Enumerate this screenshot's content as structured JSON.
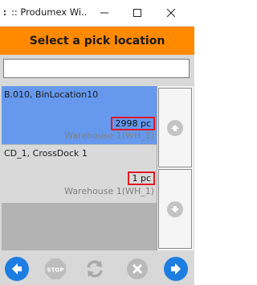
{
  "window": {
    "title": ":: Produmex Wi..."
  },
  "header": {
    "title": "Select a pick location"
  },
  "filter": {
    "value": "",
    "placeholder": ""
  },
  "locations": [
    {
      "name": "B.010, BinLocation10",
      "quantity": "2998 pc",
      "warehouse": "Warehouse 1(WH_1)",
      "selected": true
    },
    {
      "name": "CD_1, CrossDock 1",
      "quantity": "1 pc",
      "warehouse": "Warehouse 1(WH_1)",
      "selected": false
    }
  ],
  "colors": {
    "header": "#ff8a00",
    "selected_row": "#6699ee",
    "quantity_highlight": "#e01b24",
    "primary_button": "#1e7de0"
  },
  "icons": {
    "minimize": "minimize-icon",
    "maximize": "maximize-icon",
    "close": "close-icon",
    "scroll_up": "arrow-up-icon",
    "scroll_down": "arrow-down-icon",
    "back": "arrow-left-icon",
    "stop": "stop-icon",
    "refresh": "refresh-icon",
    "cancel": "cancel-icon",
    "next": "arrow-right-icon"
  },
  "toolbar": {
    "stop_label": "STOP"
  }
}
